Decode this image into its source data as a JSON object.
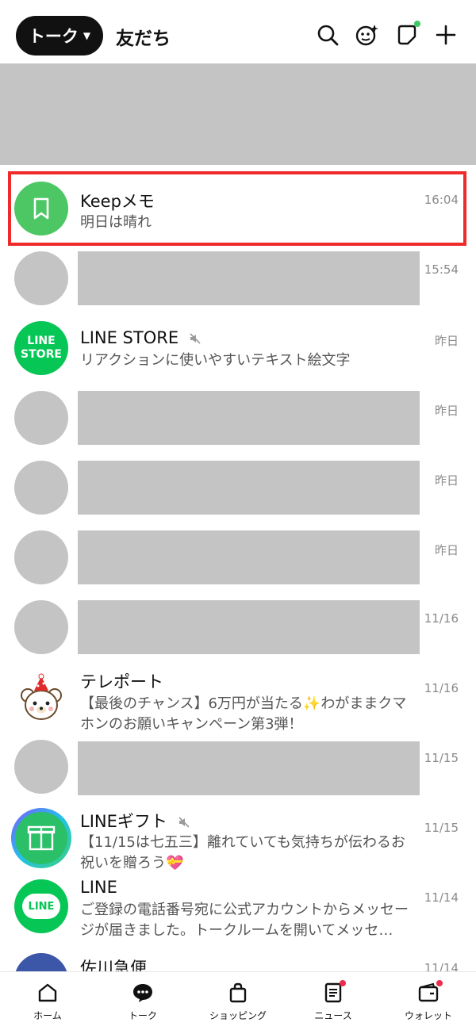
{
  "header": {
    "talk_label": "トーク",
    "friends_label": "友だち",
    "icons": [
      "search-icon",
      "face-sparkle-icon",
      "note-icon",
      "plus-icon"
    ],
    "accent_dot_color": "#3fc763"
  },
  "chats": [
    {
      "name": "Keepメモ",
      "message": "明日は晴れ",
      "time": "16:04",
      "avatar": "keep-memo",
      "highlighted": true
    },
    {
      "name": "",
      "message": "",
      "time": "15:54",
      "avatar": "redacted"
    },
    {
      "name": "LINE STORE",
      "message": "リアクションに使いやすいテキスト絵文字",
      "time": "昨日",
      "avatar": "line-store",
      "muted": true,
      "avatar_text": [
        "LINE",
        "STORE"
      ]
    },
    {
      "name": "",
      "message": "",
      "time": "昨日",
      "avatar": "redacted"
    },
    {
      "name": "",
      "message": "",
      "time": "昨日",
      "avatar": "redacted"
    },
    {
      "name": "",
      "message": "",
      "time": "昨日",
      "avatar": "redacted"
    },
    {
      "name": "",
      "message": "",
      "time": "11/16",
      "avatar": "redacted"
    },
    {
      "name": "テレポート",
      "message": "【最後のチャンス】6万円が当たる✨わがままクマホンのお願いキャンペーン第3弾！",
      "time": "11/16",
      "avatar": "bear"
    },
    {
      "name": "",
      "message": "",
      "time": "11/15",
      "avatar": "redacted"
    },
    {
      "name": "LINEギフト",
      "message": "【11/15は七五三】離れていても気持ちが伝わるお祝いを贈ろう💝",
      "time": "11/15",
      "avatar": "gift",
      "muted": true
    },
    {
      "name": "LINE",
      "message": "ご登録の電話番号宛に公式アカウントからメッセージが届きました。トークルームを開いてメッセ…",
      "time": "11/14",
      "avatar": "line",
      "avatar_text": "LINE"
    },
    {
      "name": "佐川急便",
      "message": "",
      "time": "11/14",
      "avatar": "sagawa"
    }
  ],
  "nav": [
    {
      "label": "ホーム",
      "icon": "home-icon"
    },
    {
      "label": "トーク",
      "icon": "chat-bubble-icon",
      "active": true
    },
    {
      "label": "ショッピング",
      "icon": "shopping-bag-icon"
    },
    {
      "label": "ニュース",
      "icon": "news-icon",
      "badge": true
    },
    {
      "label": "ウォレット",
      "icon": "wallet-icon",
      "badge": true
    }
  ],
  "colors": {
    "line_green": "#06c755",
    "keep_green": "#4cc764",
    "highlight_red": "#ee2a2a",
    "badge_red": "#ee2b4a",
    "redaction_gray": "#c4c4c4"
  }
}
